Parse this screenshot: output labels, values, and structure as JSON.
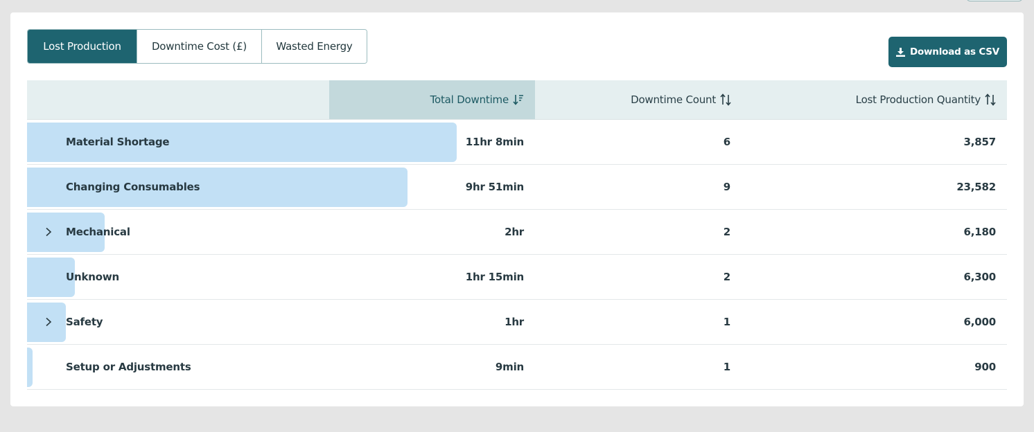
{
  "tabs": [
    {
      "label": "Lost Production",
      "active": true
    },
    {
      "label": "Downtime Cost (£)",
      "active": false
    },
    {
      "label": "Wasted Energy",
      "active": false
    }
  ],
  "download_label": "Download as CSV",
  "columns": {
    "total": "Total Downtime",
    "count": "Downtime Count",
    "lost": "Lost Production Quantity"
  },
  "rows": [
    {
      "name": "Material Shortage",
      "total": "11hr 8min",
      "count": "6",
      "lost": "3,857",
      "expandable": false,
      "share": 1.0
    },
    {
      "name": "Changing Consumables",
      "total": "9hr 51min",
      "count": "9",
      "lost": "23,582",
      "expandable": false,
      "share": 0.885
    },
    {
      "name": "Mechanical",
      "total": "2hr",
      "count": "2",
      "lost": "6,180",
      "expandable": true,
      "share": 0.18
    },
    {
      "name": "Unknown",
      "total": "1hr 15min",
      "count": "2",
      "lost": "6,300",
      "expandable": false,
      "share": 0.112
    },
    {
      "name": "Safety",
      "total": "1hr",
      "count": "1",
      "lost": "6,000",
      "expandable": true,
      "share": 0.09
    },
    {
      "name": "Setup or Adjustments",
      "total": "9min",
      "count": "1",
      "lost": "900",
      "expandable": false,
      "share": 0.013
    }
  ],
  "colors": {
    "accent": "#1e6470",
    "bar": "#c2e0f5",
    "header_bg": "#e5eff0",
    "sorted_header_bg": "#c3d9dc"
  }
}
